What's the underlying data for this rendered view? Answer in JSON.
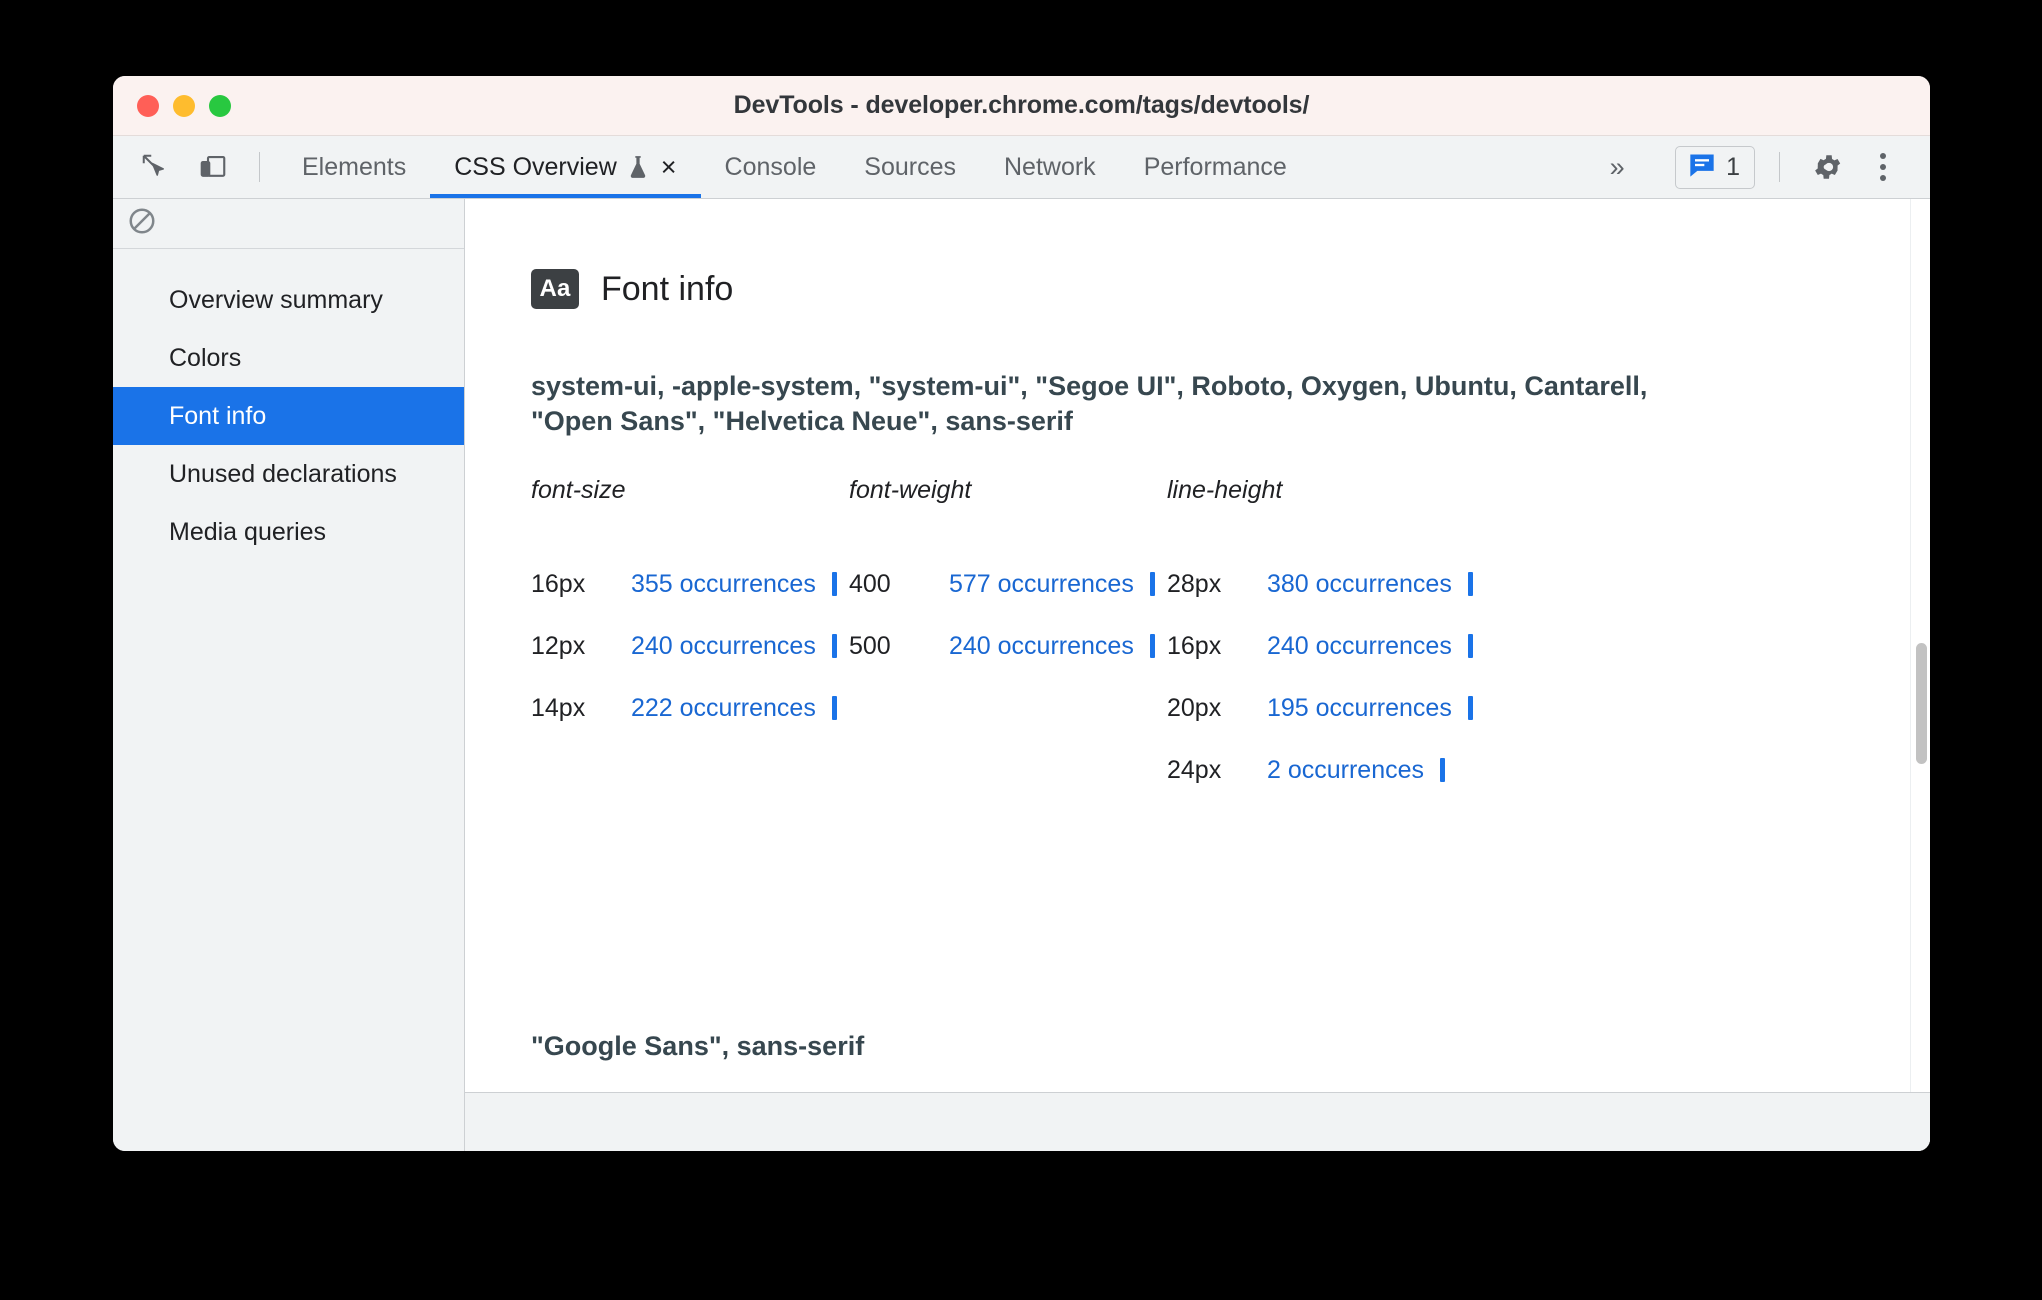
{
  "window": {
    "title": "DevTools - developer.chrome.com/tags/devtools/"
  },
  "toolbar": {
    "inspect_icon": "inspect-cursor-icon",
    "device_toggle_icon": "device-toolbar-icon",
    "tabs": [
      {
        "label": "Elements",
        "active": false
      },
      {
        "label": "CSS Overview",
        "active": true,
        "experimental": true,
        "closable": true
      },
      {
        "label": "Console",
        "active": false
      },
      {
        "label": "Sources",
        "active": false
      },
      {
        "label": "Network",
        "active": false
      },
      {
        "label": "Performance",
        "active": false
      }
    ],
    "overflow_label": "»",
    "issues_count": "1",
    "issues_icon": "issues-message-icon",
    "settings_icon": "gear-icon",
    "more_icon": "kebab-menu-icon",
    "close_label": "×",
    "accent_color": "#1a73e8"
  },
  "sidebar": {
    "clear_icon": "clear-overview-icon",
    "items": [
      {
        "label": "Overview summary",
        "selected": false
      },
      {
        "label": "Colors",
        "selected": false
      },
      {
        "label": "Font info",
        "selected": true
      },
      {
        "label": "Unused declarations",
        "selected": false
      },
      {
        "label": "Media queries",
        "selected": false
      }
    ],
    "selected_bg": "#1a73e8"
  },
  "main": {
    "section_badge": "Aa",
    "section_title": "Font info",
    "font_families": [
      "system-ui, -apple-system, \"system-ui\", \"Segoe UI\", Roboto, Oxygen, Ubuntu, Cantarell, \"Open Sans\", \"Helvetica Neue\", sans-serif",
      "\"Google Sans\", sans-serif"
    ],
    "columns": [
      {
        "header": "font-size"
      },
      {
        "header": "font-weight"
      },
      {
        "header": "line-height"
      }
    ],
    "rows": [
      {
        "font_size": {
          "value": "16px",
          "occurrences": "355 occurrences"
        },
        "font_weight": {
          "value": "400",
          "occurrences": "577 occurrences"
        },
        "line_height": {
          "value": "28px",
          "occurrences": "380 occurrences"
        }
      },
      {
        "font_size": {
          "value": "12px",
          "occurrences": "240 occurrences"
        },
        "font_weight": {
          "value": "500",
          "occurrences": "240 occurrences"
        },
        "line_height": {
          "value": "16px",
          "occurrences": "240 occurrences"
        }
      },
      {
        "font_size": {
          "value": "14px",
          "occurrences": "222 occurrences"
        },
        "font_weight": {
          "value": "",
          "occurrences": ""
        },
        "line_height": {
          "value": "20px",
          "occurrences": "195 occurrences"
        }
      },
      {
        "font_size": {
          "value": "",
          "occurrences": ""
        },
        "font_weight": {
          "value": "",
          "occurrences": ""
        },
        "line_height": {
          "value": "24px",
          "occurrences": "2 occurrences"
        }
      }
    ],
    "link_color": "#1967d2"
  }
}
